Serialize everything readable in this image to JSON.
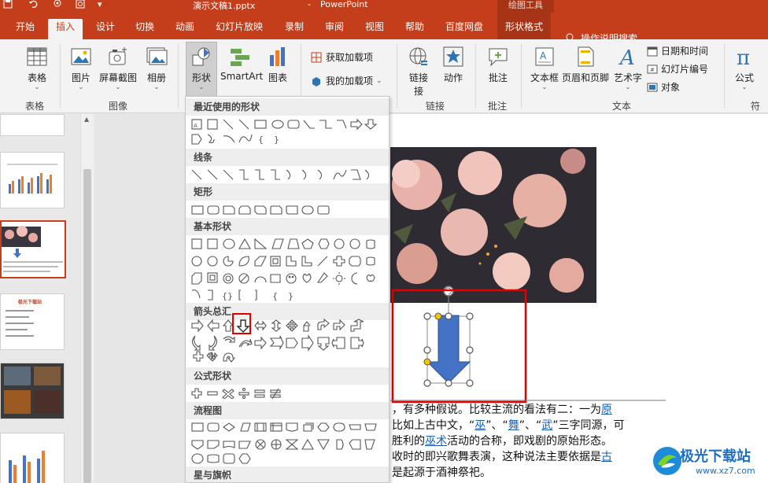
{
  "titlebar": {
    "doc_name": "演示文稿1.pptx",
    "separator": "-",
    "app_name": "PowerPoint",
    "context_group": "绘图工具"
  },
  "tabs": [
    "开始",
    "插入",
    "设计",
    "切换",
    "动画",
    "幻灯片放映",
    "录制",
    "审阅",
    "视图",
    "帮助",
    "百度网盘"
  ],
  "active_tab": "插入",
  "context_tab": "形状格式",
  "tell_me": "操作说明搜索",
  "ribbon": {
    "table": "表格",
    "group_table": "表格",
    "picture": "图片",
    "screenshot": "屏幕截图",
    "album": "相册",
    "group_image": "图像",
    "shapes": "形状",
    "smartart": "SmartArt",
    "chart": "图表",
    "get_addins": "获取加载项",
    "my_addins": "我的加载项",
    "link": "链接",
    "link_line2": "接",
    "action": "动作",
    "group_link": "链接",
    "comment": "批注",
    "group_comment": "批注",
    "textbox": "文本框",
    "header_footer": "页眉和页脚",
    "wordart": "艺术字",
    "date_time": "日期和时间",
    "slide_number": "幻灯片编号",
    "object": "对象",
    "group_text": "文本",
    "equation": "公式",
    "group_symbol": "符号"
  },
  "gallery": {
    "sections": [
      "最近使用的形状",
      "线条",
      "矩形",
      "基本形状",
      "箭头总汇",
      "公式形状",
      "流程图",
      "星与旗帜"
    ]
  },
  "thumbs": {
    "slide4_title": "极光下载站"
  },
  "slide": {
    "line1_pre": "，有多种假说。比较主流的看法有二：一为",
    "line1_link": "原",
    "line2_pre": "比如上古中文，“",
    "line2_w1": "巫",
    "line2_mid1": "”、“",
    "line2_w2": "舞",
    "line2_mid2": "”、“",
    "line2_w3": "武",
    "line2_post": "”三字同源，可",
    "line3_pre": "胜利的",
    "line3_link": "巫术",
    "line3_post": "活动的合称，即戏剧的原始形态。",
    "line4_pre": "收时的即兴歌舞表演，这种说法主要依据是",
    "line4_link": "古",
    "line5": "是起源于酒神祭祀。"
  },
  "watermark": {
    "name": "极光下载站",
    "url": "www.xz7.com"
  },
  "colors": {
    "accent": "#c43e1c",
    "highlight_box": "#e00000",
    "arrow_fill": "#4472c4",
    "adjust_handle": "#f5c400"
  }
}
